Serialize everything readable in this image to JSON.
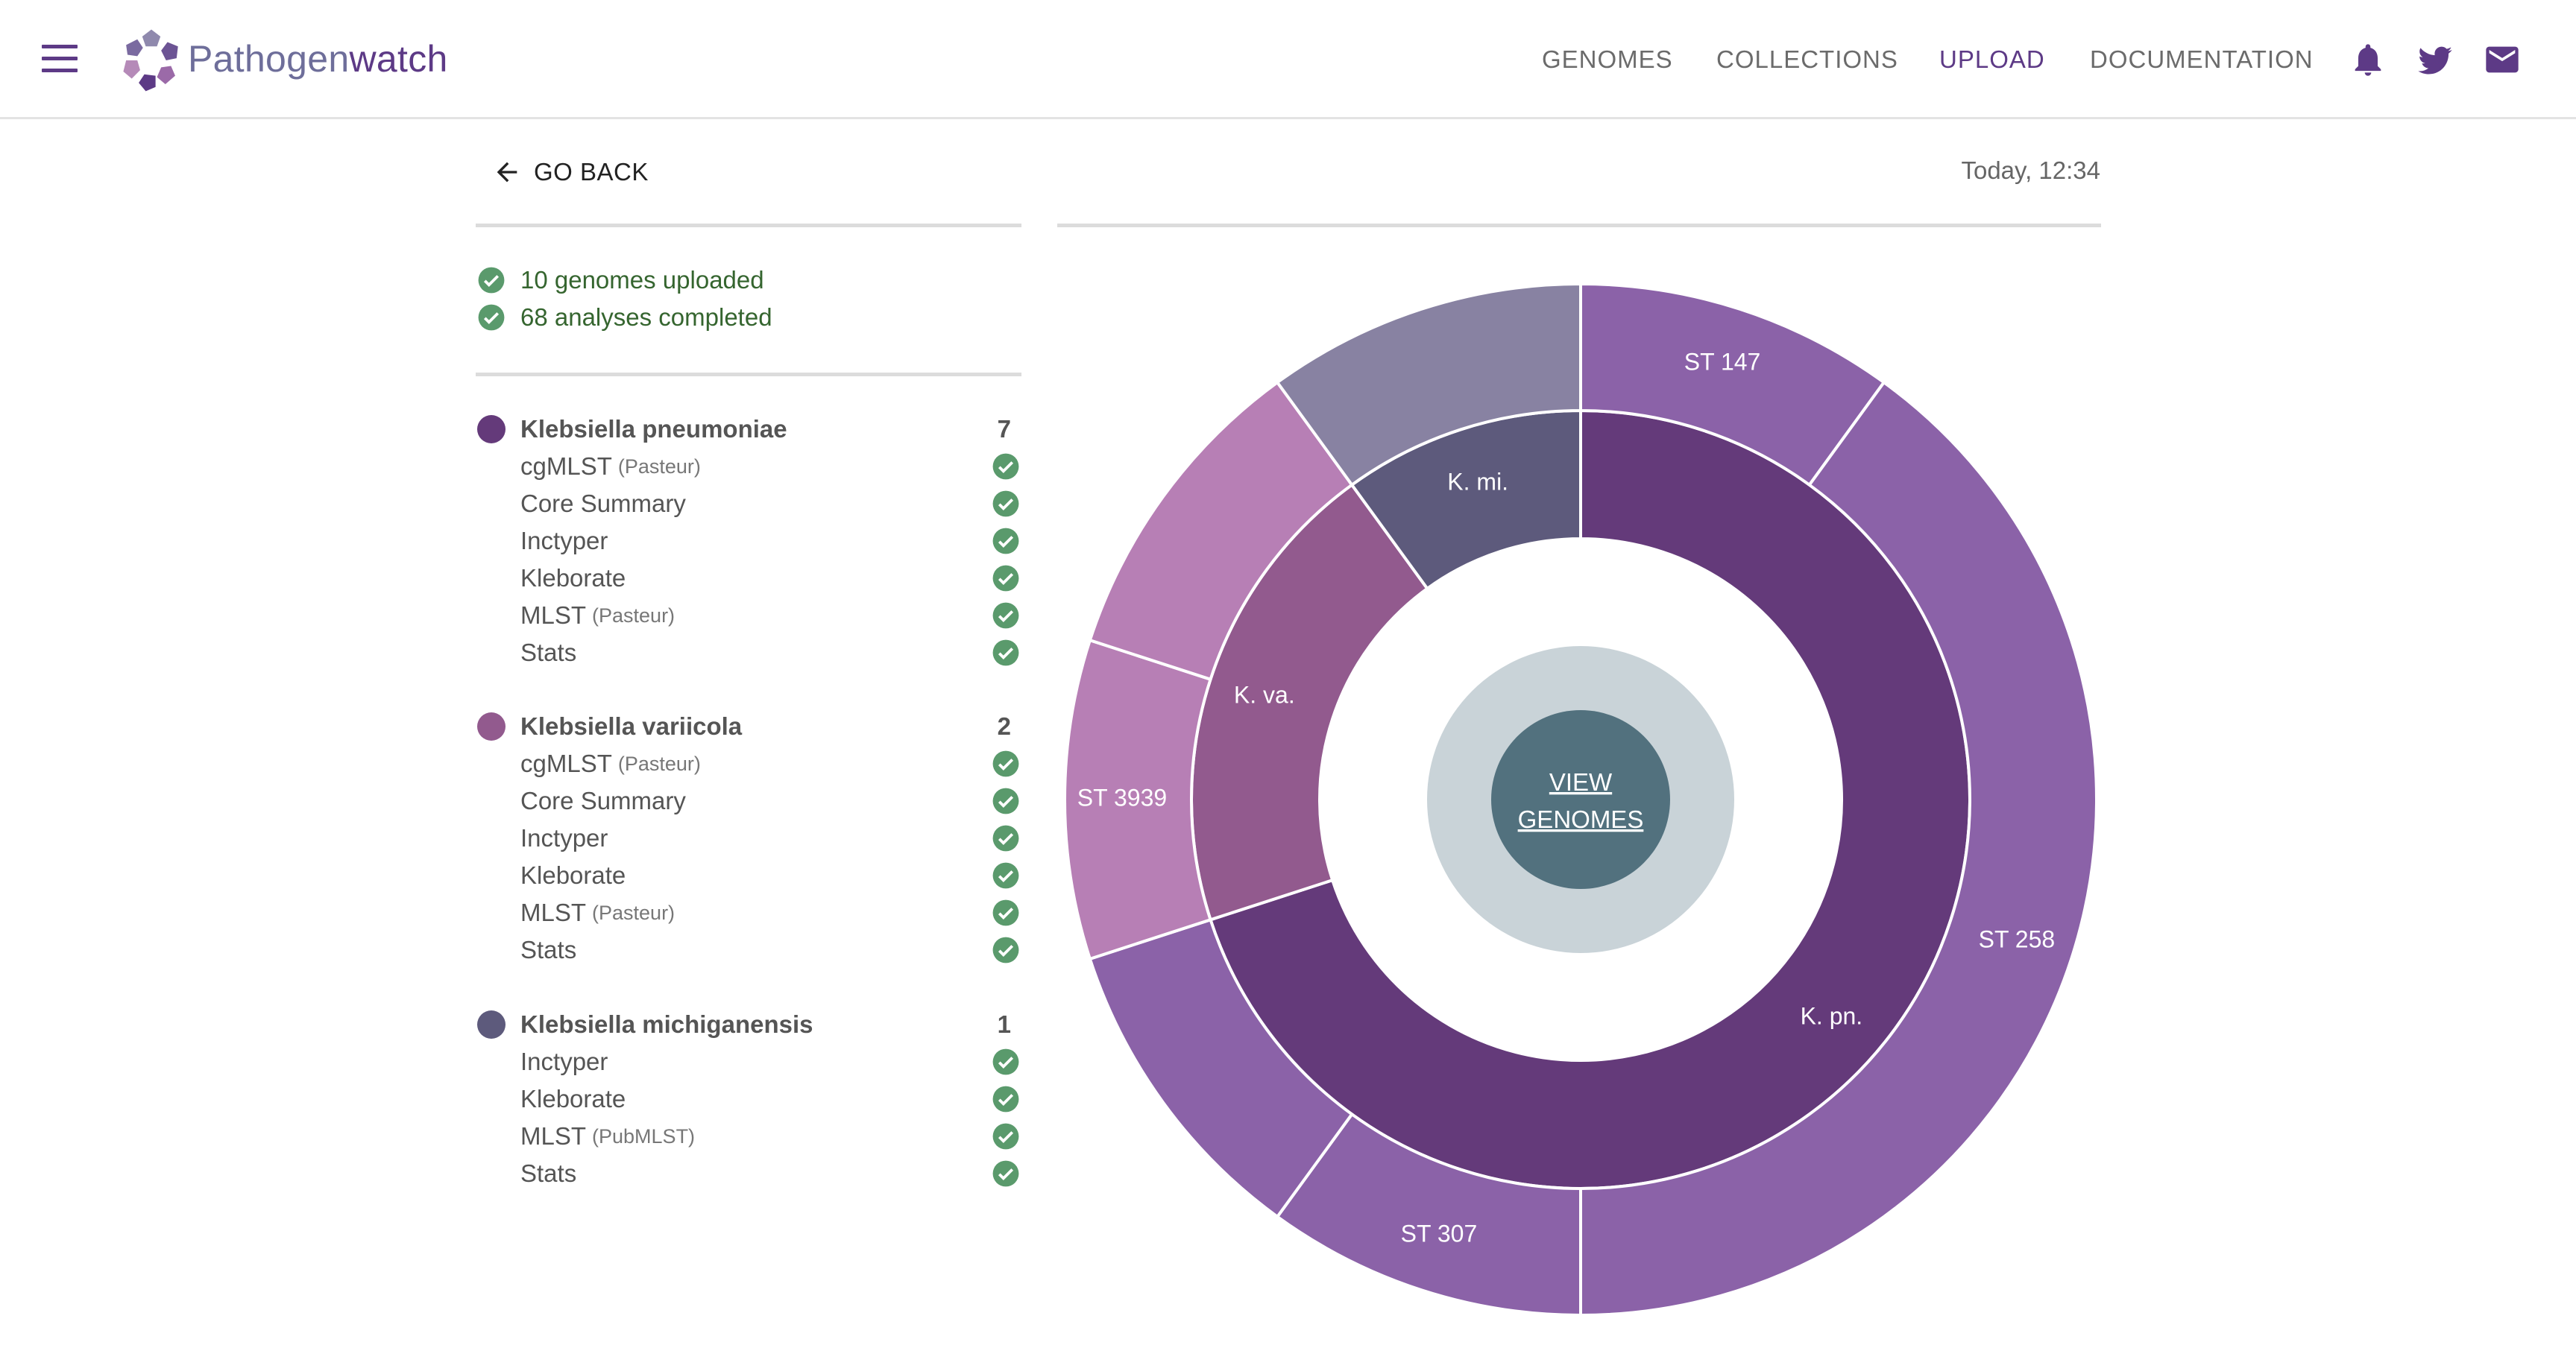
{
  "header": {
    "brand_part1": "Pathogen",
    "brand_part2": "watch",
    "nav": [
      "GENOMES",
      "COLLECTIONS",
      "UPLOAD",
      "DOCUMENTATION"
    ],
    "active_nav": "UPLOAD",
    "icons": [
      "menu-icon",
      "bell-icon",
      "twitter-icon",
      "mail-icon"
    ]
  },
  "toolbar": {
    "back_label": "GO BACK",
    "timestamp": "Today, 12:34"
  },
  "summary": [
    "10 genomes uploaded",
    "68 analyses completed"
  ],
  "species": [
    {
      "name": "Klebsiella pneumoniae",
      "count": "7",
      "color": "#643a7a",
      "tasks": [
        {
          "name": "cgMLST",
          "note": "(Pasteur)"
        },
        {
          "name": "Core Summary",
          "note": ""
        },
        {
          "name": "Inctyper",
          "note": ""
        },
        {
          "name": "Kleborate",
          "note": ""
        },
        {
          "name": "MLST",
          "note": "(Pasteur)"
        },
        {
          "name": "Stats",
          "note": ""
        }
      ]
    },
    {
      "name": "Klebsiella variicola",
      "count": "2",
      "color": "#925a8e",
      "tasks": [
        {
          "name": "cgMLST",
          "note": "(Pasteur)"
        },
        {
          "name": "Core Summary",
          "note": ""
        },
        {
          "name": "Inctyper",
          "note": ""
        },
        {
          "name": "Kleborate",
          "note": ""
        },
        {
          "name": "MLST",
          "note": "(Pasteur)"
        },
        {
          "name": "Stats",
          "note": ""
        }
      ]
    },
    {
      "name": "Klebsiella michiganensis",
      "count": "1",
      "color": "#5d5a7c",
      "tasks": [
        {
          "name": "Inctyper",
          "note": ""
        },
        {
          "name": "Kleborate",
          "note": ""
        },
        {
          "name": "MLST",
          "note": "(PubMLST)"
        },
        {
          "name": "Stats",
          "note": ""
        }
      ]
    }
  ],
  "center_button": {
    "line1": "VIEW",
    "line2": "GENOMES"
  },
  "chart_data": {
    "type": "sunburst",
    "total": 10,
    "inner_ring": [
      {
        "label": "K. pn.",
        "value": 7,
        "color": "#643a7a"
      },
      {
        "label": "K. va.",
        "value": 2,
        "color": "#925a8e"
      },
      {
        "label": "K. mi.",
        "value": 1,
        "color": "#5d5a7c"
      }
    ],
    "outer_ring": [
      {
        "label": "ST 147",
        "value": 1,
        "parent": "K. pn.",
        "color": "#8b62a8"
      },
      {
        "label": "ST 258",
        "value": 4,
        "parent": "K. pn.",
        "color": "#8b62a8"
      },
      {
        "label": "ST 307",
        "value": 1,
        "parent": "K. pn.",
        "color": "#8b62a8"
      },
      {
        "label": "",
        "value": 1,
        "parent": "K. pn.",
        "color": "#8b62a8"
      },
      {
        "label": "ST 3939",
        "value": 1,
        "parent": "K. va.",
        "color": "#b77fb5"
      },
      {
        "label": "",
        "value": 1,
        "parent": "K. va.",
        "color": "#b77fb5"
      },
      {
        "label": "",
        "value": 1,
        "parent": "K. mi.",
        "color": "#8882a2"
      }
    ],
    "status_color": "#5a9a6c"
  }
}
